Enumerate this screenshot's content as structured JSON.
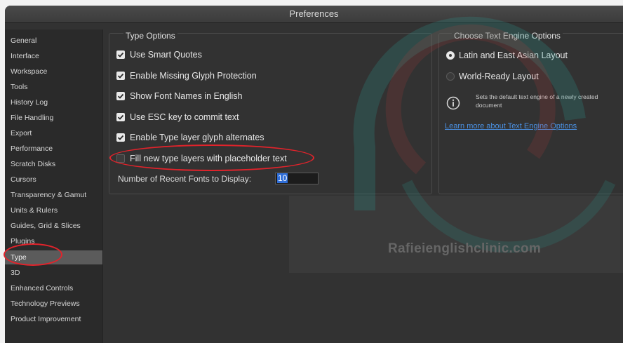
{
  "window": {
    "title": "Preferences"
  },
  "sidebar": {
    "items": [
      {
        "label": "General"
      },
      {
        "label": "Interface"
      },
      {
        "label": "Workspace"
      },
      {
        "label": "Tools"
      },
      {
        "label": "History Log"
      },
      {
        "label": "File Handling"
      },
      {
        "label": "Export"
      },
      {
        "label": "Performance"
      },
      {
        "label": "Scratch Disks"
      },
      {
        "label": "Cursors"
      },
      {
        "label": "Transparency & Gamut"
      },
      {
        "label": "Units & Rulers"
      },
      {
        "label": "Guides, Grid & Slices"
      },
      {
        "label": "Plugins"
      },
      {
        "label": "Type",
        "selected": true
      },
      {
        "label": "3D"
      },
      {
        "label": "Enhanced Controls"
      },
      {
        "label": "Technology Previews"
      },
      {
        "label": "Product Improvement"
      }
    ]
  },
  "type_options": {
    "title": "Type Options",
    "checkboxes": [
      {
        "label": "Use Smart Quotes",
        "checked": true
      },
      {
        "label": "Enable Missing Glyph Protection",
        "checked": true
      },
      {
        "label": "Show Font Names in English",
        "checked": true
      },
      {
        "label": "Use ESC key to commit text",
        "checked": true
      },
      {
        "label": "Enable Type layer glyph alternates",
        "checked": true
      },
      {
        "label": "Fill new type layers with placeholder text",
        "checked": false
      }
    ],
    "recent_fonts_label": "Number of Recent Fonts to Display:",
    "recent_fonts_value": "10"
  },
  "text_engine": {
    "title": "Choose Text Engine Options",
    "options": [
      {
        "label": "Latin and East Asian Layout",
        "selected": true
      },
      {
        "label": "World-Ready Layout",
        "selected": false
      }
    ],
    "info_text": "Sets the default text engine of a newly created document",
    "link_text": "Learn more about Text Engine Options"
  },
  "watermark": {
    "text": "Rafieienglishclinic.com"
  },
  "colors": {
    "annotation": "#e2232b",
    "link": "#4a90e2",
    "window_bg": "#323232"
  }
}
